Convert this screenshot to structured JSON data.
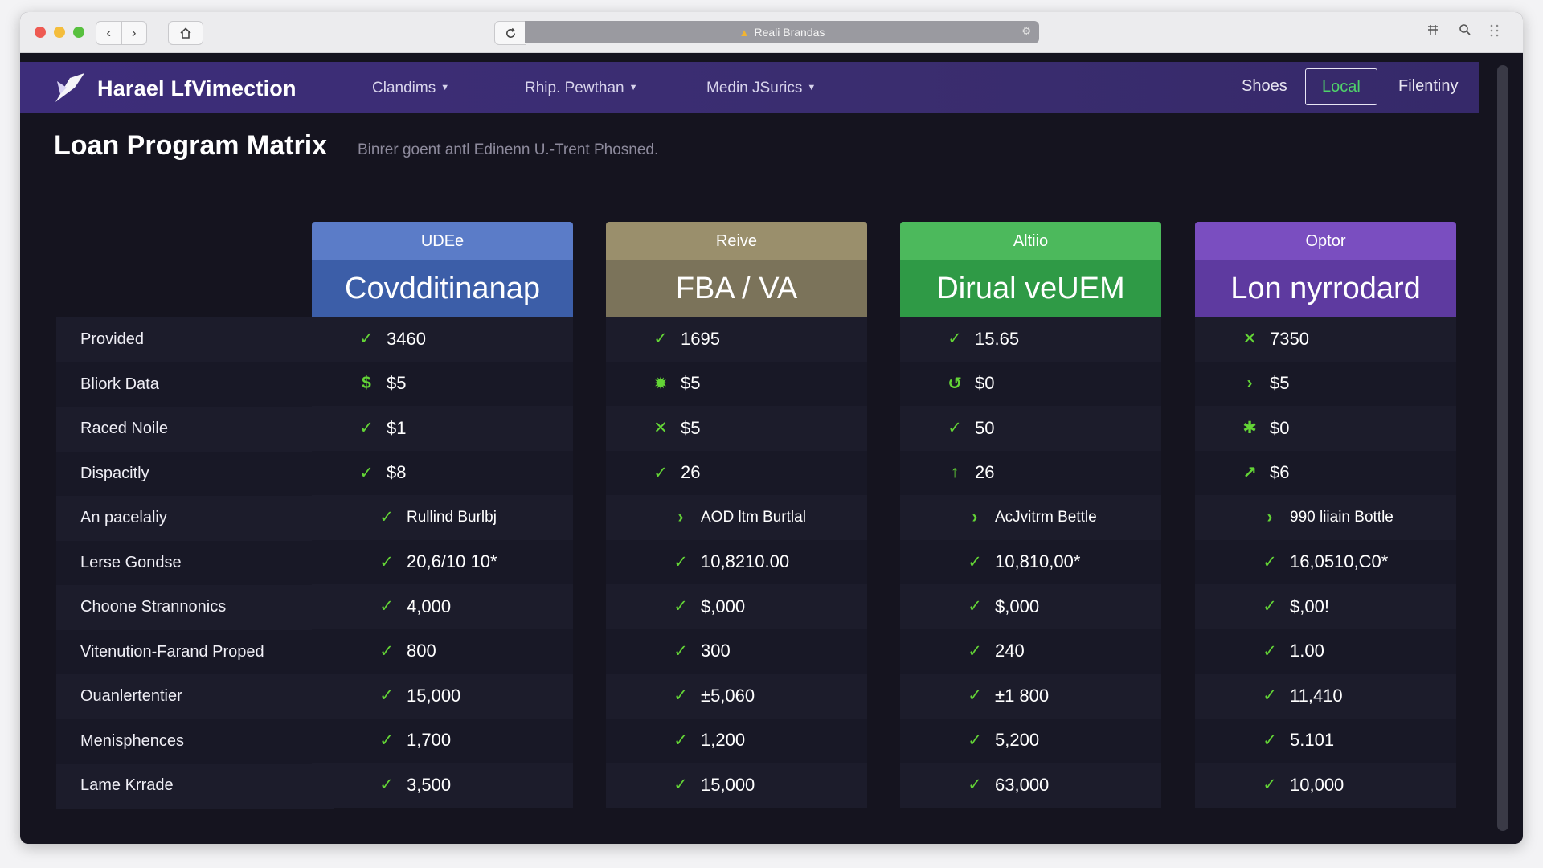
{
  "browser": {
    "url_text": "Reali Brandas",
    "back_icon": "‹",
    "forward_icon": "›"
  },
  "site": {
    "brand": "Harael LfVimection",
    "menus": [
      "Clandims",
      "Rhip. Pewthan",
      "Medin JSurics"
    ],
    "links": [
      "Shoes",
      "Local",
      "Filentiny"
    ]
  },
  "page": {
    "title": "Loan Program Matrix",
    "subtitle": "Binrer goent antl Edinenn U.-Trent Phosned."
  },
  "row_labels": [
    "Provided",
    "Bliork Data",
    "Raced Noile",
    "Dispacitly",
    "An pacelaliy",
    "Lerse Gondse",
    "Choone Strannonics",
    "Vitenution-Farand Proped",
    "Ouanlertentier",
    "Menisphences",
    "Lame Krrade"
  ],
  "plans": [
    {
      "tier": "UDEe",
      "name": "Covdditinanap",
      "tier_color": "#5b7cc8",
      "name_color": "#3c5ea8",
      "cells": [
        {
          "icon": "check",
          "value": "3460"
        },
        {
          "icon": "dollar",
          "value": "$5"
        },
        {
          "icon": "check",
          "value": "$1"
        },
        {
          "icon": "check",
          "value": "$8"
        },
        {
          "icon": "check",
          "value": "Rullind Burlbj"
        },
        {
          "icon": "check",
          "value": "20,6/10 10*"
        },
        {
          "icon": "check",
          "value": "4,000"
        },
        {
          "icon": "check",
          "value": "800"
        },
        {
          "icon": "check",
          "value": "15,000"
        },
        {
          "icon": "check",
          "value": "1,700"
        },
        {
          "icon": "check",
          "value": "3,500"
        }
      ]
    },
    {
      "tier": "Reive",
      "name": "FBA / VA",
      "tier_color": "#9a8f6c",
      "name_color": "#7b735a",
      "cells": [
        {
          "icon": "check",
          "value": "1695"
        },
        {
          "icon": "gear",
          "value": "$5"
        },
        {
          "icon": "cross",
          "value": "$5"
        },
        {
          "icon": "check",
          "value": "26"
        },
        {
          "icon": "chevron",
          "value": "AOD ltm Burtlal"
        },
        {
          "icon": "check",
          "value": "10,8210.00"
        },
        {
          "icon": "check",
          "value": "$,000"
        },
        {
          "icon": "check",
          "value": "300"
        },
        {
          "icon": "check",
          "value": "±5,060"
        },
        {
          "icon": "check",
          "value": "1,200"
        },
        {
          "icon": "check",
          "value": "15,000"
        }
      ]
    },
    {
      "tier": "Altiio",
      "name": "Dirual veUEM",
      "tier_color": "#4cb95c",
      "name_color": "#2f9a46",
      "cells": [
        {
          "icon": "check",
          "value": "15.65"
        },
        {
          "icon": "refresh",
          "value": "$0"
        },
        {
          "icon": "check",
          "value": "50"
        },
        {
          "icon": "arrow-up",
          "value": "26"
        },
        {
          "icon": "chevron",
          "value": "AcJvitrm Bettle"
        },
        {
          "icon": "check",
          "value": "10,810,00*"
        },
        {
          "icon": "check",
          "value": "$,000"
        },
        {
          "icon": "check",
          "value": "240"
        },
        {
          "icon": "check",
          "value": "±1 800"
        },
        {
          "icon": "check",
          "value": "5,200"
        },
        {
          "icon": "check",
          "value": "63,000"
        }
      ]
    },
    {
      "tier": "Optor",
      "name": "Lon nyrrodard",
      "tier_color": "#7a4ec0",
      "name_color": "#5e3aa0",
      "cells": [
        {
          "icon": "cross",
          "value": "7350"
        },
        {
          "icon": "chevron",
          "value": "$5"
        },
        {
          "icon": "sparkle",
          "value": "$0"
        },
        {
          "icon": "arrow-diag",
          "value": "$6"
        },
        {
          "icon": "chevron",
          "value": "990 liiain Bottle"
        },
        {
          "icon": "check",
          "value": "16,0510,C0*"
        },
        {
          "icon": "check",
          "value": "$,00!"
        },
        {
          "icon": "check",
          "value": "1.00"
        },
        {
          "icon": "check",
          "value": "11,410"
        },
        {
          "icon": "check",
          "value": "5.101"
        },
        {
          "icon": "check",
          "value": "10,000"
        }
      ]
    }
  ]
}
